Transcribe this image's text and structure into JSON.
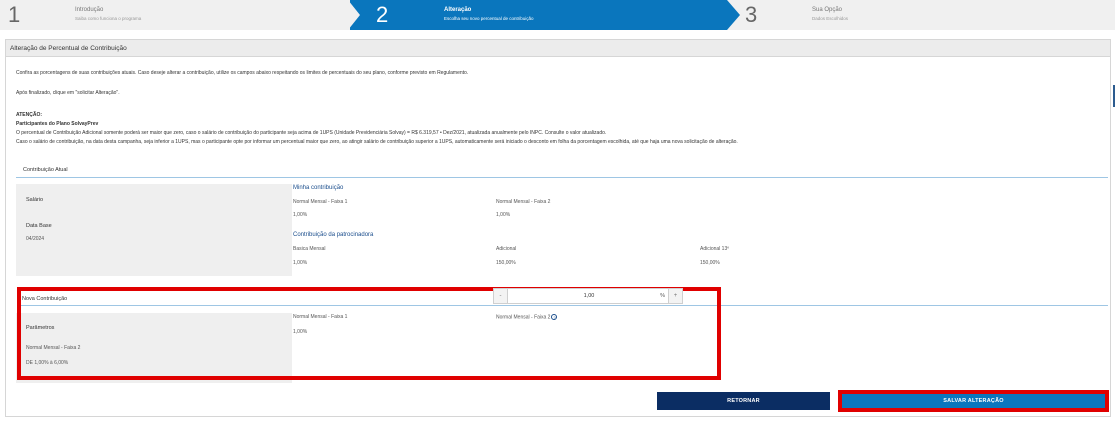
{
  "stepper": {
    "steps": [
      {
        "number": "1",
        "title": "Introdução",
        "subtitle": "Saiba como funciona o programa"
      },
      {
        "number": "2",
        "title": "Alteração",
        "subtitle": "Escolha seu novo percentual de contribuição"
      },
      {
        "number": "3",
        "title": "Sua Opção",
        "subtitle": "Dados Escolhidos"
      }
    ]
  },
  "panel": {
    "title": "Alteração de Percentual de Contribuição",
    "intro": "Confira as porcentagens de suas contribuições atuais. Caso deseje alterar a contribuição, utilize os campos abaixo respeitando os limites de percentuais do seu plano, conforme previsto em Regulamento.",
    "after": "Após finalizado, clique em \"solicitar Alteração\".",
    "attention": "ATENÇÃO:",
    "participants": "Participantes do Plano SolvayPrev",
    "para1": "O percentual de Contribuição Adicional somente poderá ser maior que zero, caso o salário de contribuição do participante seja acima de 1UPS (Unidade Previdenciária Solvay) = R$ 6.319,57 • Dez/2021, atualizada anualmente pelo INPC. Consulte o valor atualizado.",
    "para2": "Caso o salário de contribuição, na data desta campanha, seja inferior a 1UPS, mas o participante opte por informar um percentual maior que zero, ao atingir salário de contribuição superior a 1UPS, automaticamente será iniciado o desconto em folha da porcentagem escolhida, até que haja uma nova solicitação de alteração."
  },
  "current": {
    "section_title": "Contribuição Atual",
    "salary_label": "Salário",
    "database_label": "Data Base",
    "database_value": "04/2024",
    "my_contribution": "Minha contribuição",
    "faixa1_label": "Normal Mensal - Faixa 1",
    "faixa1_value": "1,00%",
    "faixa2_label": "Normal Mensal - Faixa 2",
    "faixa2_value": "1,00%",
    "sponsor": "Contribuição da patrocinadora",
    "basic_label": "Basica Mensal",
    "basic_value": "1,00%",
    "additional_label": "Adicional",
    "additional_value": "150,00%",
    "additional13_label": "Adicional 13º",
    "additional13_value": "150,00%"
  },
  "new": {
    "section_title": "Nova Contribuição",
    "params_label": "Parâmetros",
    "params_item": "Normal Mensal - Faixa 2",
    "params_range": "DE 1,00% à 6,00%",
    "faixa1_label": "Normal Mensal - Faixa 1",
    "faixa1_value": "1,00%",
    "faixa2_label": "Normal Mensal - Faixa 2",
    "input_value": "1,00",
    "minus": "-",
    "plus": "+",
    "percent": "%"
  },
  "buttons": {
    "back": "RETORNAR",
    "save": "SALVAR ALTERAÇÃO"
  },
  "colors": {
    "active_step": "#0a76bd",
    "dark_button": "#0b2d63",
    "highlight": "#e00000"
  }
}
